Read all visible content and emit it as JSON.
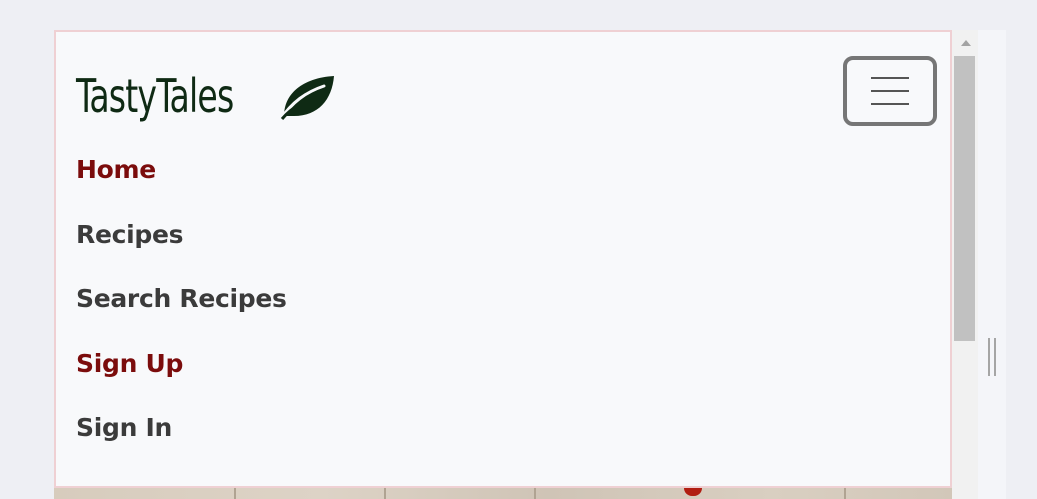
{
  "brand": {
    "name": "TastyTales",
    "icon": "leaf-icon",
    "color": "#0f2a14"
  },
  "toggler": {
    "icon": "hamburger-icon"
  },
  "nav": {
    "items": [
      {
        "label": "Home",
        "active": true
      },
      {
        "label": "Recipes",
        "active": false
      },
      {
        "label": "Search Recipes",
        "active": false
      },
      {
        "label": "Sign Up",
        "active": true
      },
      {
        "label": "Sign In",
        "active": false
      }
    ],
    "active_color": "#7b0c0c",
    "text_color": "#3b3b3b"
  },
  "colors": {
    "nav_border": "#efd0d3",
    "nav_background": "#f8f9fb"
  }
}
